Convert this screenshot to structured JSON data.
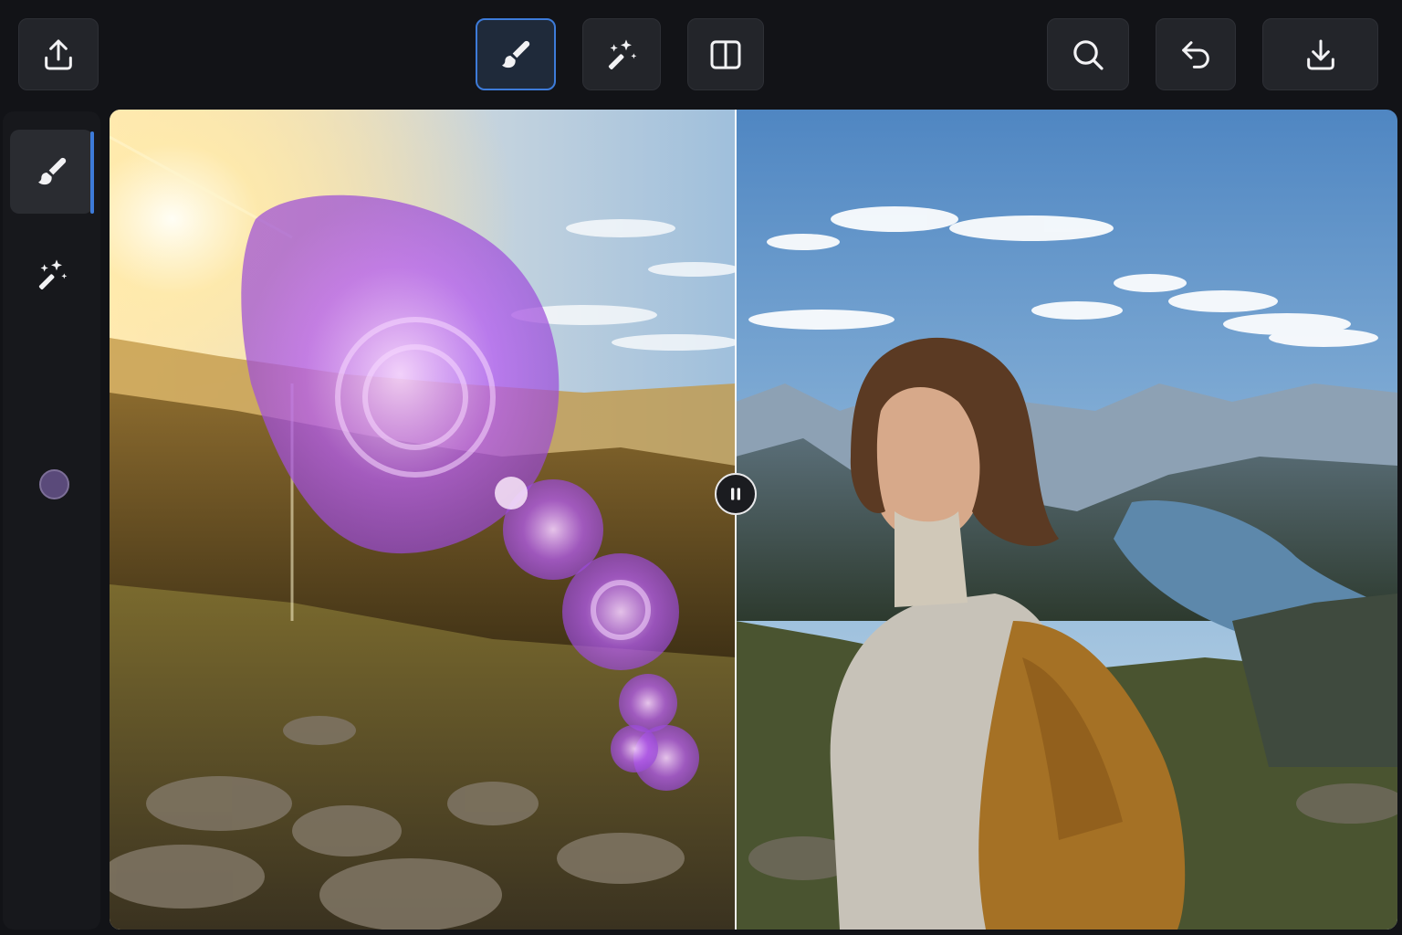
{
  "toolbar": {
    "left": [
      {
        "icon": "upload-icon"
      }
    ],
    "center": [
      {
        "icon": "brush-icon",
        "active": true
      },
      {
        "icon": "magic-wand-icon",
        "active": false
      },
      {
        "icon": "split-view-icon",
        "active": false
      }
    ],
    "right": [
      {
        "icon": "search-icon"
      },
      {
        "icon": "undo-icon"
      },
      {
        "icon": "download-icon"
      }
    ]
  },
  "sidebar": {
    "tools": [
      {
        "icon": "brush-icon",
        "active": true
      },
      {
        "icon": "sparkles-icon",
        "active": false
      }
    ],
    "brush_color": "#5a4a7a"
  },
  "canvas": {
    "mode": "before-after-compare",
    "mask_color": "#b45cf0",
    "divider_handle_icon": "pause-icon"
  },
  "colors": {
    "background": "#121317",
    "button": "#23252a",
    "accent": "#3d7bd9"
  }
}
